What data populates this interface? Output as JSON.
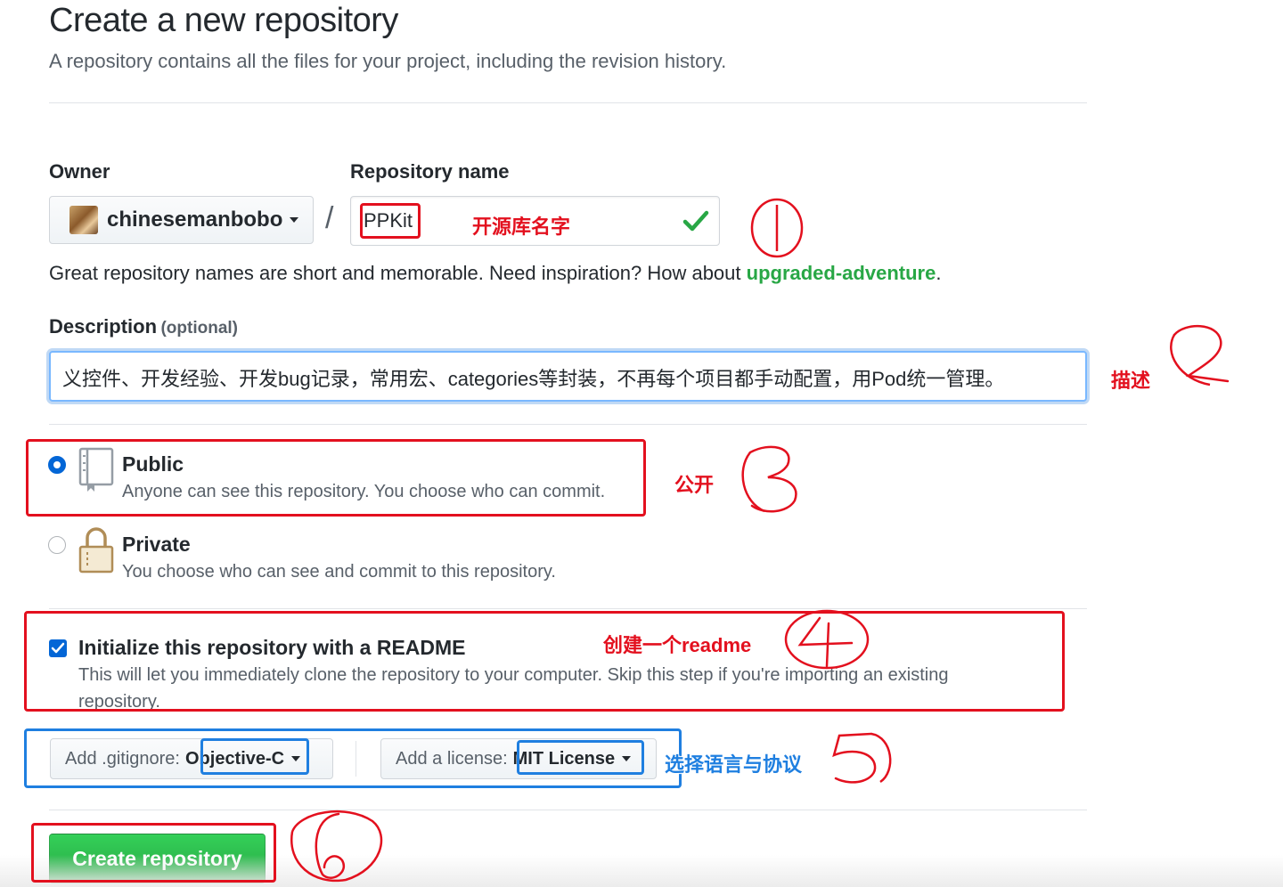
{
  "header": {
    "title": "Create a new repository",
    "subtitle": "A repository contains all the files for your project, including the revision history."
  },
  "owner": {
    "label": "Owner",
    "value": "chinesemanbobo"
  },
  "repo_name": {
    "label": "Repository name",
    "value": "PPKit",
    "valid_icon": "check-icon"
  },
  "hint": {
    "text": "Great repository names are short and memorable. Need inspiration? How about ",
    "suggestion": "upgraded-adventure",
    "end": "."
  },
  "description": {
    "label": "Description",
    "optional": "(optional)",
    "value": "义控件、开发经验、开发bug记录，常用宏、categories等封装，不再每个项目都手动配置，用Pod统一管理。"
  },
  "visibility": {
    "selected": "public",
    "public": {
      "title": "Public",
      "desc": "Anyone can see this repository. You choose who can commit.",
      "icon": "repo-book-icon"
    },
    "private": {
      "title": "Private",
      "desc": "You choose who can see and commit to this repository.",
      "icon": "lock-icon"
    }
  },
  "readme": {
    "checked": true,
    "title": "Initialize this repository with a README",
    "desc_line1": "This will let you immediately clone the repository to your computer. Skip this step if you're importing an existing",
    "desc_line2": "repository."
  },
  "gitignore": {
    "prefix": "Add .gitignore:",
    "value": "Objective-C"
  },
  "license": {
    "prefix": "Add a license:",
    "value": "MIT License"
  },
  "create_button": "Create repository",
  "annotations": {
    "repo_name_note": "开源库名字",
    "description_note": "描述",
    "public_note": "公开",
    "readme_note": "创建一个readme",
    "select_note": "选择语言与协议",
    "step_1": "1",
    "step_2": "2",
    "step_3": "3",
    "step_4": "4",
    "step_5": "5",
    "step_6": "6",
    "red": "#e3101e",
    "blue": "#1f7fe0"
  },
  "colors": {
    "primary_green": "#28a745",
    "focus_blue": "#0366d6"
  }
}
